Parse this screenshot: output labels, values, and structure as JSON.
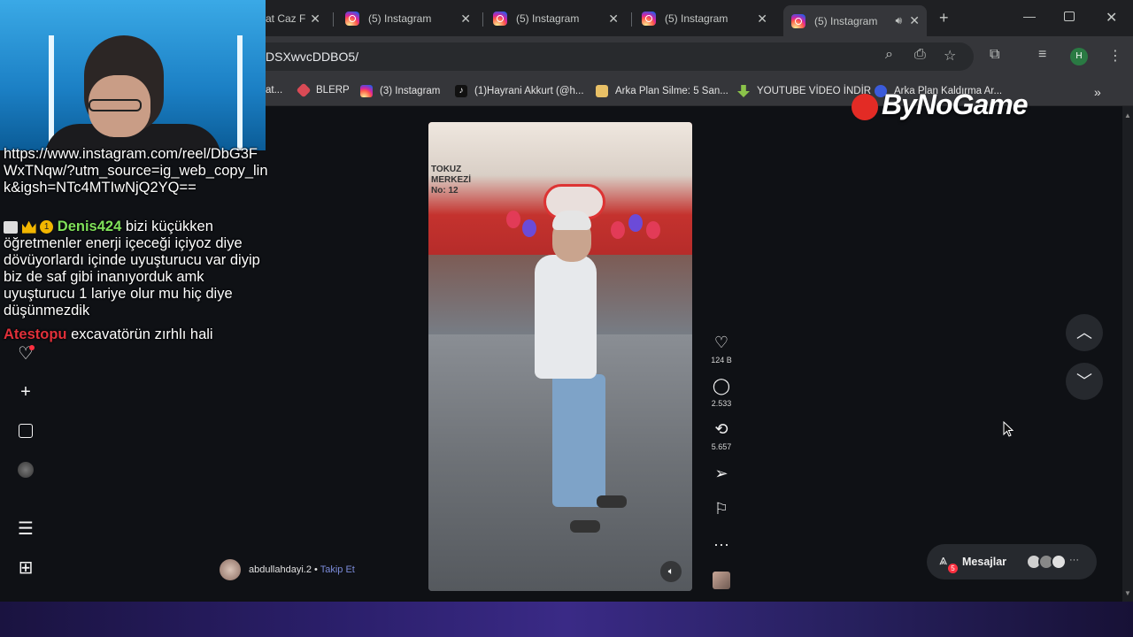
{
  "browser": {
    "tabs": [
      {
        "title": "at Caz F",
        "partial": true
      },
      {
        "title": "(5) Instagram"
      },
      {
        "title": "(5) Instagram"
      },
      {
        "title": "(5) Instagram"
      },
      {
        "title": "(5) Instagram",
        "active": true,
        "audio": true
      }
    ],
    "address": "DSXwvcDDBO5/",
    "profile_initial": "H",
    "bookmarks": [
      {
        "label": "at...",
        "icon": "generic"
      },
      {
        "label": "BLERP",
        "icon": "blerp-icon",
        "color": "#d94a55"
      },
      {
        "label": "(3) Instagram",
        "icon": "instagram-icon"
      },
      {
        "label": "(1)Hayrani Akkurt (@h...",
        "icon": "tiktok-icon"
      },
      {
        "label": "Arka Plan Silme: 5 San...",
        "icon": "layers-icon",
        "color": "#e8c066"
      },
      {
        "label": "YOUTUBE VİDEO İNDİR",
        "icon": "download-icon",
        "color": "#8bc34a"
      },
      {
        "label": "Arka Plan Kaldırma Ar...",
        "icon": "generic"
      }
    ]
  },
  "chat": [
    {
      "text": "https://www.instagram.com/reel/DbG3FWxTNqw/?utm_source=ig_web_copy_link&igsh=NTc4MTIwNjQ2YQ=="
    },
    {
      "user": "Denis424",
      "user_color": "#7fe05a",
      "badge": "1",
      "text": "bizi küçükken öğretmenler enerji içeceği içiyoz diye dövüyorlardı içinde uyuşturucu var diyip biz de saf gibi inanıyorduk amk uyuşturucu 1 lariye olur mu hiç diye düşünmezdik"
    },
    {
      "user": "Atestopu",
      "user_color": "#e0303a",
      "text": "excavatörün zırhlı hali"
    }
  ],
  "reel": {
    "store_text": "TOKUZ\nMERKEZİ\nNo: 12",
    "actions": [
      {
        "icon": "heart-icon",
        "count": "124 B"
      },
      {
        "icon": "comment-icon",
        "count": "2.533"
      },
      {
        "icon": "repost-icon",
        "count": "5.657"
      },
      {
        "icon": "share-icon",
        "count": ""
      },
      {
        "icon": "bookmark-icon",
        "count": ""
      },
      {
        "icon": "more-icon",
        "count": ""
      }
    ],
    "author": "abdullahdayi.2",
    "separator": "•",
    "follow": "Takip Et"
  },
  "messages": {
    "label": "Mesajlar",
    "badge": "5"
  },
  "watermark": "ByNoGame"
}
